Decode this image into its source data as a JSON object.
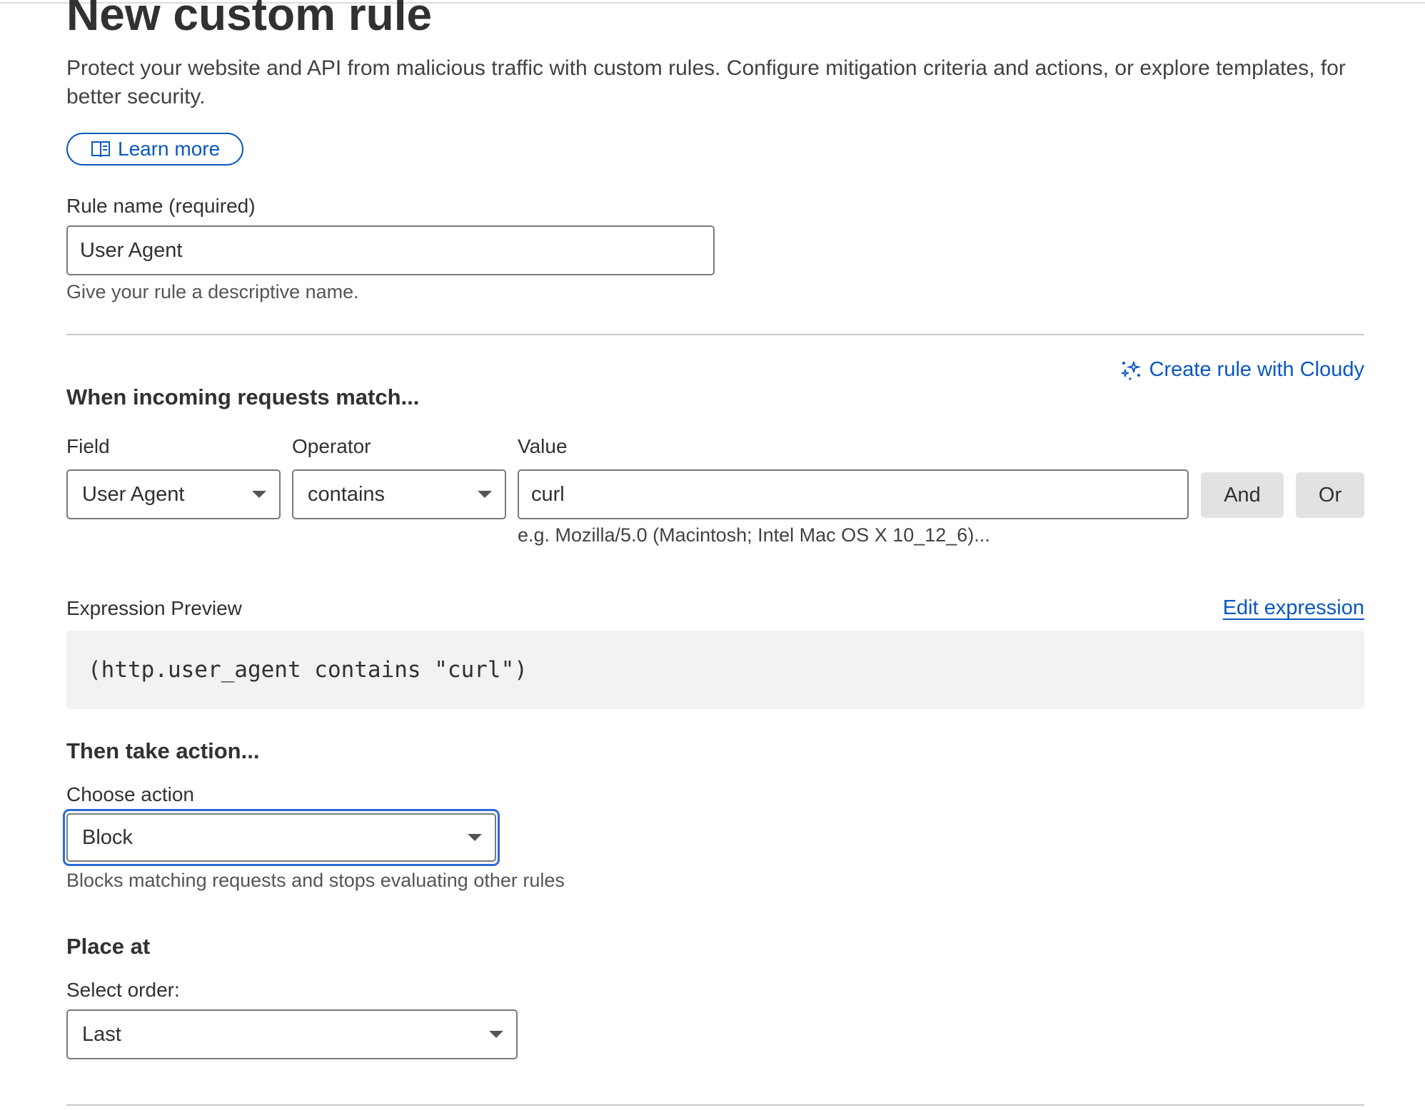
{
  "page": {
    "title": "New custom rule",
    "description": "Protect your website and API from malicious traffic with custom rules. Configure mitigation criteria and actions, or explore templates, for better security.",
    "learn_more_label": "Learn more"
  },
  "rule_name": {
    "label": "Rule name (required)",
    "value": "User Agent",
    "helper": "Give your rule a descriptive name."
  },
  "match": {
    "heading": "When incoming requests match...",
    "cloudy_link": "Create rule with Cloudy",
    "field_label": "Field",
    "field_value": "User Agent",
    "operator_label": "Operator",
    "operator_value": "contains",
    "value_label": "Value",
    "value_value": "curl",
    "value_helper": "e.g. Mozilla/5.0 (Macintosh; Intel Mac OS X 10_12_6)...",
    "and_label": "And",
    "or_label": "Or"
  },
  "expression": {
    "label": "Expression Preview",
    "edit_label": "Edit expression",
    "preview": "(http.user_agent contains \"curl\")"
  },
  "action": {
    "heading": "Then take action...",
    "label": "Choose action",
    "value": "Block",
    "helper": "Blocks matching requests and stops evaluating other rules"
  },
  "place": {
    "heading": "Place at",
    "label": "Select order:",
    "value": "Last"
  },
  "colors": {
    "accent": "#0a57c2",
    "focus": "#2c6bd8",
    "button_gray": "#e2e2e2",
    "expression_bg": "#f2f2f2"
  },
  "icons": {
    "learn_more": "book-icon",
    "cloudy": "sparkle-icon",
    "dropdown": "caret-down-icon"
  }
}
